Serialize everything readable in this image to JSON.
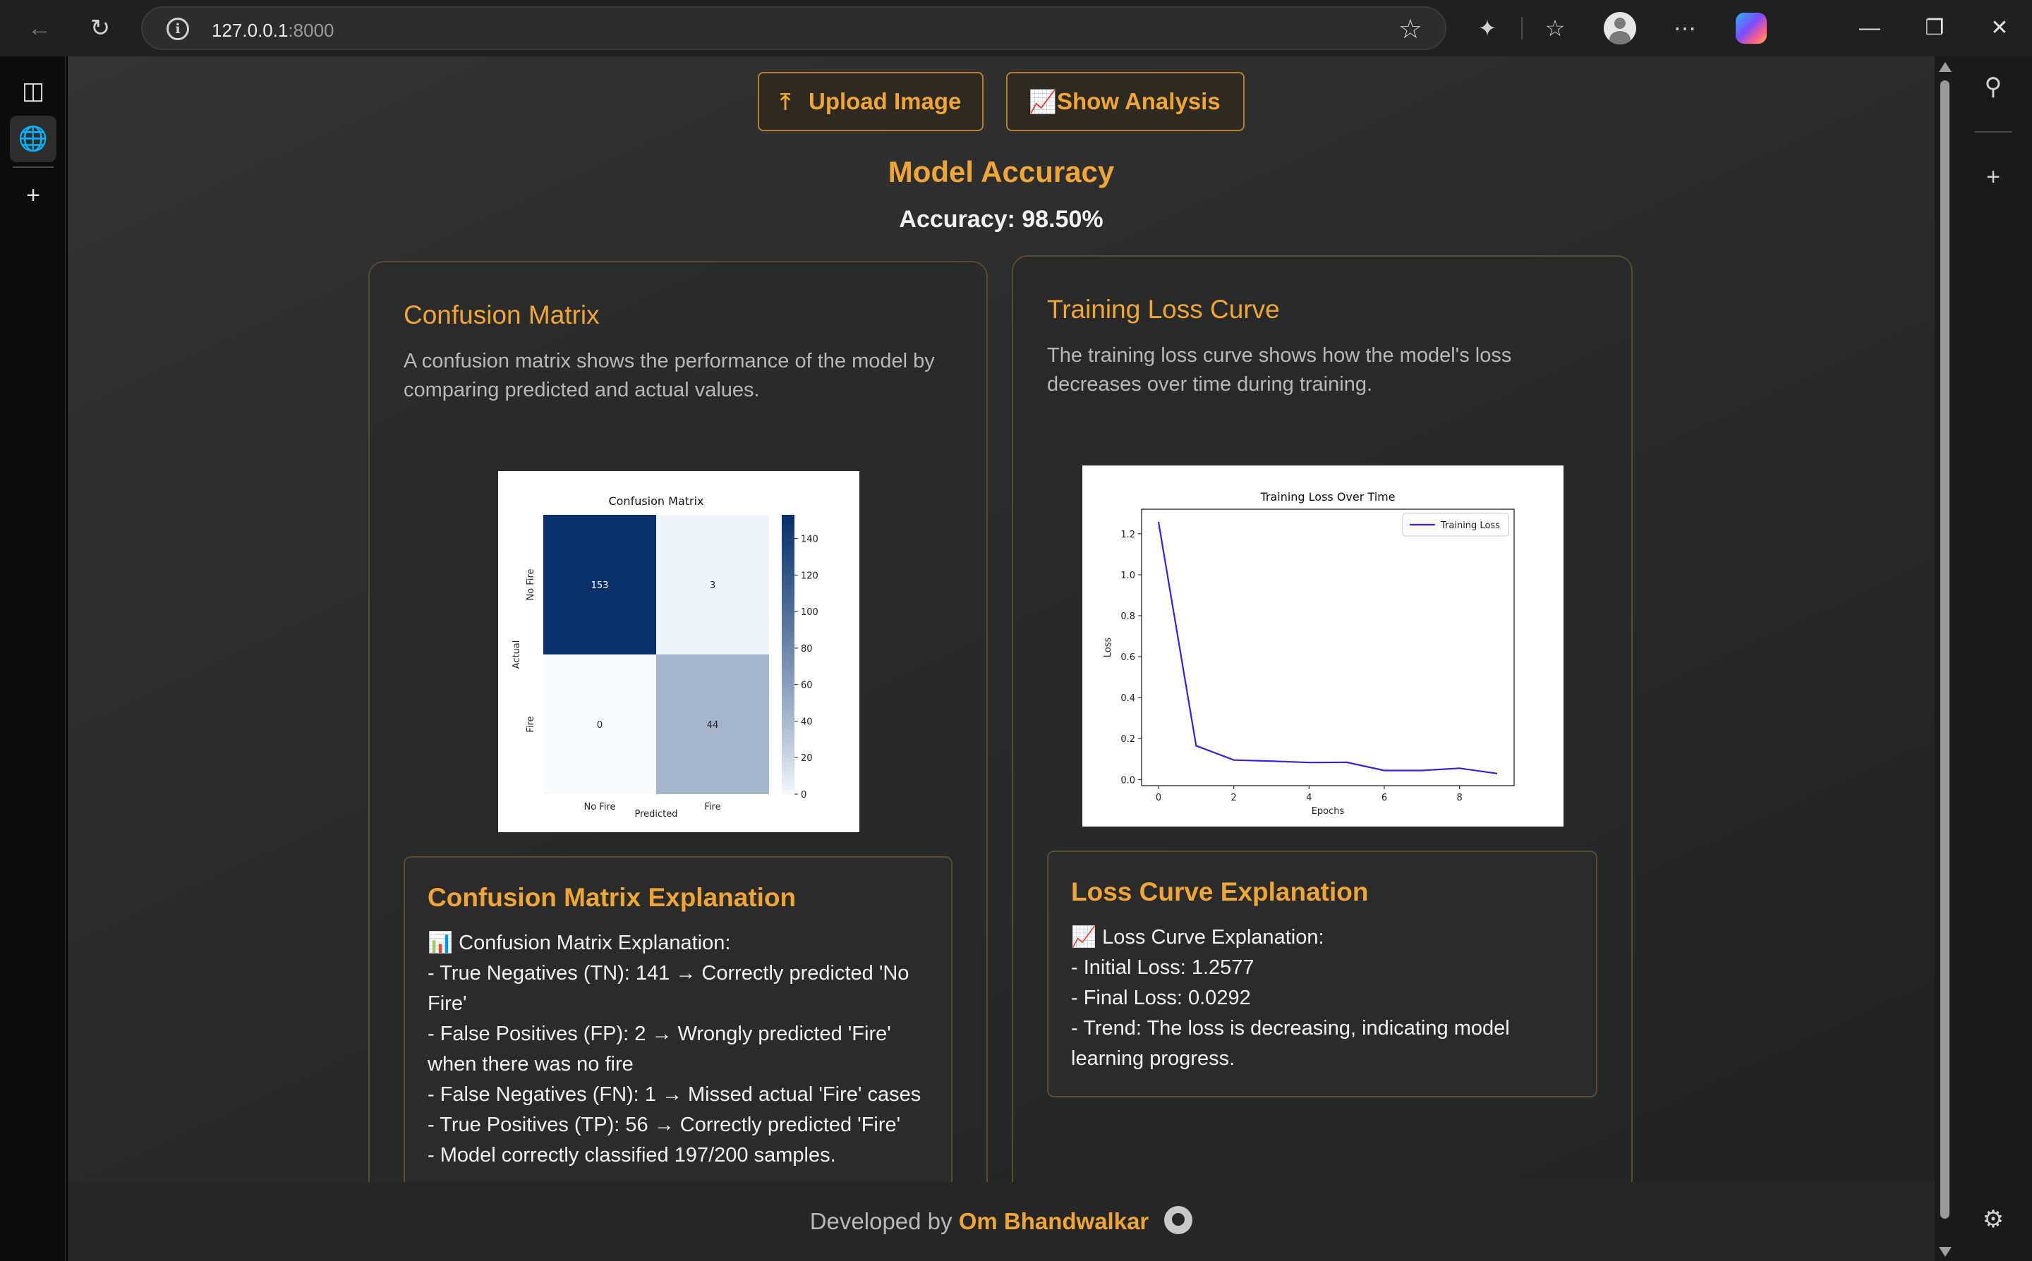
{
  "browser": {
    "url_host": "127.0.0.1",
    "url_port": ":8000"
  },
  "toolbar": {
    "upload_label": "Upload Image",
    "analysis_label": "Show Analysis"
  },
  "model": {
    "title": "Model Accuracy",
    "accuracy_text": "Accuracy: 98.50%"
  },
  "confusion_card": {
    "title": "Confusion Matrix",
    "description": "A confusion matrix shows the performance of the model by comparing predicted and actual values.",
    "explanation_title": "Confusion Matrix Explanation",
    "explanation_lines": [
      "📊 Confusion Matrix Explanation:",
      "- True Negatives (TN): 141 → Correctly predicted 'No Fire'",
      "- False Positives (FP): 2 → Wrongly predicted 'Fire' when there was no fire",
      "- False Negatives (FN): 1 → Missed actual 'Fire' cases",
      "- True Positives (TP): 56 → Correctly predicted 'Fire'",
      "- Model correctly classified 197/200 samples."
    ]
  },
  "loss_card": {
    "title": "Training Loss Curve",
    "description": "The training loss curve shows how the model's loss decreases over time during training.",
    "explanation_title": "Loss Curve Explanation",
    "explanation_lines": [
      "📈 Loss Curve Explanation:",
      "- Initial Loss: 1.2577",
      "- Final Loss: 0.0292",
      "- Trend: The loss is decreasing, indicating model learning progress."
    ]
  },
  "footer": {
    "prefix": "Developed by ",
    "name": "Om Bhandwalkar"
  },
  "chart_data": [
    {
      "type": "heatmap",
      "title": "Confusion Matrix",
      "xlabel": "Predicted",
      "ylabel": "Actual",
      "x_categories": [
        "No Fire",
        "Fire"
      ],
      "y_categories": [
        "No Fire",
        "Fire"
      ],
      "values": [
        [
          153,
          3
        ],
        [
          0,
          44
        ]
      ],
      "colorbar_ticks": [
        0,
        20,
        40,
        60,
        80,
        100,
        120,
        140
      ],
      "colorbar_range": [
        0,
        153
      ],
      "colormap": [
        "#f7fbff",
        "#08306b"
      ]
    },
    {
      "type": "line",
      "title": "Training Loss Over Time",
      "xlabel": "Epochs",
      "ylabel": "Loss",
      "series": [
        {
          "name": "Training Loss",
          "color": "#3a1fd6",
          "x": [
            0,
            1,
            2,
            3,
            4,
            5,
            6,
            7,
            8,
            9
          ],
          "values": [
            1.2577,
            0.165,
            0.095,
            0.09,
            0.083,
            0.084,
            0.044,
            0.044,
            0.055,
            0.0292
          ]
        }
      ],
      "xlim": [
        -0.45,
        9.45
      ],
      "ylim": [
        -0.03,
        1.32
      ],
      "xticks": [
        0,
        2,
        4,
        6,
        8
      ],
      "yticks": [
        0.0,
        0.2,
        0.4,
        0.6,
        0.8,
        1.0,
        1.2
      ],
      "legend": "top-right",
      "grid": false
    }
  ]
}
